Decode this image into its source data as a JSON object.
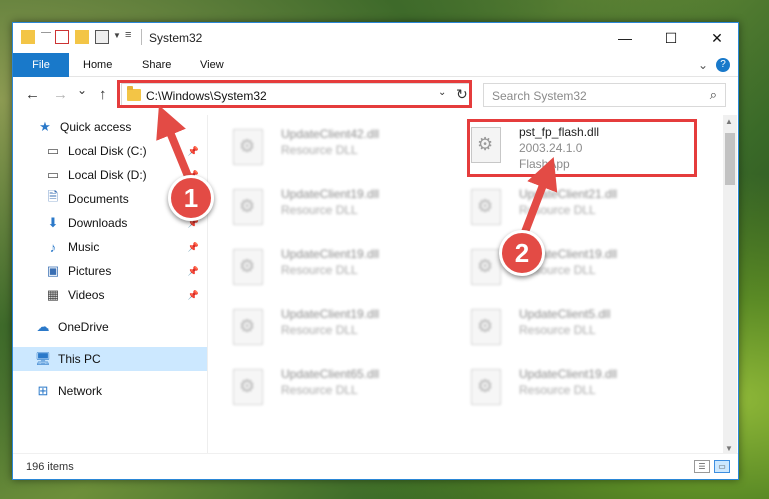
{
  "window": {
    "title": "System32",
    "controls": {
      "minimize": "—",
      "maximize": "☐",
      "close": "✕"
    }
  },
  "ribbon": {
    "tabs": [
      "File",
      "Home",
      "Share",
      "View"
    ],
    "expand_icon": "chevron-down-icon",
    "help_icon": "help-icon"
  },
  "nav": {
    "back": "←",
    "forward": "→",
    "recent": "⌄",
    "up": "↑",
    "address": "C:\\Windows\\System32",
    "refresh": "↻",
    "search_placeholder": "Search System32",
    "search_icon": "⌕"
  },
  "sidebar": {
    "items": [
      {
        "label": "Quick access",
        "icon": "★",
        "icon_name": "star-icon",
        "pinned": false
      },
      {
        "label": "Local Disk (C:)",
        "icon": "▭",
        "icon_name": "drive-icon",
        "pinned": true
      },
      {
        "label": "Local Disk (D:)",
        "icon": "▭",
        "icon_name": "drive-icon",
        "pinned": true
      },
      {
        "label": "Documents",
        "icon": "🗎",
        "icon_name": "documents-icon",
        "pinned": true
      },
      {
        "label": "Downloads",
        "icon": "⬇",
        "icon_name": "downloads-icon",
        "pinned": true
      },
      {
        "label": "Music",
        "icon": "♪",
        "icon_name": "music-icon",
        "pinned": true
      },
      {
        "label": "Pictures",
        "icon": "▣",
        "icon_name": "pictures-icon",
        "pinned": true
      },
      {
        "label": "Videos",
        "icon": "▦",
        "icon_name": "videos-icon",
        "pinned": true
      },
      {
        "label": "OneDrive",
        "icon": "☁",
        "icon_name": "cloud-icon",
        "pinned": false
      },
      {
        "label": "This PC",
        "icon": "🖥",
        "icon_name": "computer-icon",
        "pinned": false,
        "selected": true
      },
      {
        "label": "Network",
        "icon": "⊞",
        "icon_name": "network-icon",
        "pinned": false
      }
    ],
    "pin_glyph": "📌"
  },
  "files": {
    "left_column": [
      {
        "name": "UpdateClient42.dll",
        "type": "Resource DLL"
      },
      {
        "name": "UpdateClient19.dll",
        "type": "Resource DLL"
      },
      {
        "name": "UpdateClient19.dll",
        "type": "Resource DLL"
      },
      {
        "name": "UpdateClient19.dll",
        "type": "Resource DLL"
      },
      {
        "name": "UpdateClient65.dll",
        "type": "Resource DLL"
      }
    ],
    "right_column": [
      {
        "name": "pst_fp_flash.dll",
        "version": "2003.24.1.0",
        "description": "FlashApp"
      },
      {
        "name": "UpdateClient21.dll",
        "type": "Resource DLL"
      },
      {
        "name": "UpdateClient19.dll",
        "type": "Resource DLL"
      },
      {
        "name": "UpdateClient5.dll",
        "type": "Resource DLL"
      },
      {
        "name": "UpdateClient19.dll",
        "type": "Resource DLL"
      }
    ]
  },
  "status": {
    "item_count": "196 items",
    "details_view": "☰",
    "tiles_view": "▭"
  },
  "annotations": {
    "step1": "1",
    "step2": "2",
    "highlight_color": "#e53c3c",
    "badge_color": "#e34b45"
  }
}
